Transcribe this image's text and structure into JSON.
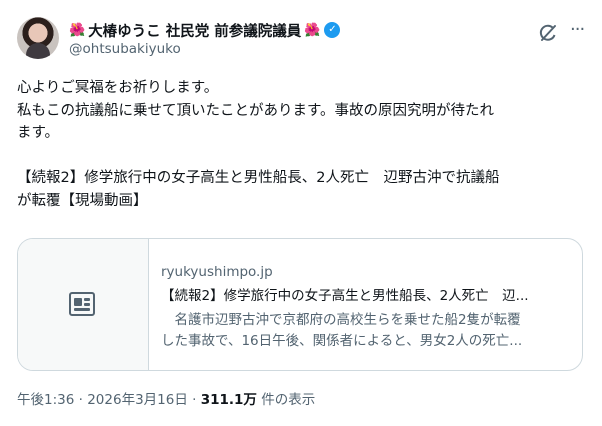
{
  "author": {
    "name_decor_left": "🌺",
    "name": "大椿ゆうこ 社民党 前参議院議員",
    "name_decor_right": "🌺",
    "verified_icon": "verified-badge",
    "handle": "@ohtsubakiyuko"
  },
  "toolbar": {
    "grok_icon": "grok-icon",
    "more_label": "···"
  },
  "tweet": {
    "line1": "心よりご冥福をお祈りします。",
    "line2": "私もこの抗議船に乗せて頂いたことがあります。事故の原因究明が待たれ\nます。",
    "line3": "【続報2】修学旅行中の女子高生と男性船長、2人死亡　辺野古沖で抗議船\nが転覆【現場動画】"
  },
  "card": {
    "domain": "ryukyushimpo.jp",
    "title": "【続報2】修学旅行中の女子高生と男性船長、2人死亡　辺...",
    "description": "　名護市辺野古沖で京都府の高校生らを乗せた船2隻が転覆\nした事故で、16日午後、関係者によると、男女2人の死亡..."
  },
  "meta": {
    "time": "午後1:36",
    "date": "2026年3月16日",
    "views": "311.1万",
    "views_label": "件の表示",
    "separator": "·"
  }
}
